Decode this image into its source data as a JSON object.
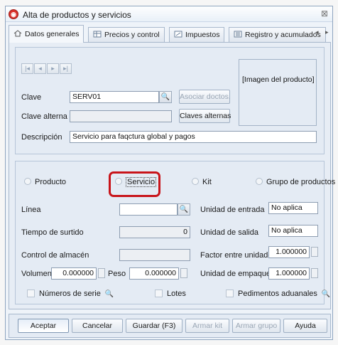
{
  "window": {
    "title": "Alta de productos y servicios",
    "close_glyph": "⊠"
  },
  "tabs": [
    {
      "label": "Datos generales",
      "icon": "home-icon"
    },
    {
      "label": "Precios y control",
      "icon": "table-icon"
    },
    {
      "label": "Impuestos",
      "icon": "tax-icon"
    },
    {
      "label": "Registro y acumulados",
      "icon": "ledger-icon"
    }
  ],
  "nav": {
    "first": "|◂",
    "prev": "◂",
    "next": "▸",
    "last": "▸|"
  },
  "form": {
    "clave_label": "Clave",
    "clave_value": "SERV01",
    "asociar_label": "Asociar doctos.",
    "clave_alterna_label": "Clave alterna",
    "clave_alterna_value": "",
    "claves_alternas_label": "Claves alternas",
    "descripcion_label": "Descripción",
    "descripcion_value": "Servicio para faqctura global y pagos",
    "image_placeholder": "[Imagen del producto]"
  },
  "type": {
    "options": [
      "Producto",
      "Servicio",
      "Kit",
      "Grupo de productos"
    ],
    "selected": "Servicio"
  },
  "details": {
    "linea_label": "Línea",
    "linea_value": "",
    "tiempo_label": "Tiempo de surtido",
    "tiempo_value": "0",
    "control_label": "Control de almacén",
    "control_value": "",
    "volumen_label": "Volumen",
    "volumen_value": "0.000000",
    "peso_label": "Peso",
    "peso_value": "0.000000",
    "unidad_entrada_label": "Unidad de entrada",
    "unidad_entrada_value": "No aplica",
    "unidad_salida_label": "Unidad de salida",
    "unidad_salida_value": "No aplica",
    "factor_label": "Factor entre unidades",
    "factor_value": "1.000000",
    "empaque_label": "Unidad de empaque",
    "empaque_value": "1.000000",
    "numeros_serie_label": "Números de serie",
    "lotes_label": "Lotes",
    "pedimentos_label": "Pedimentos aduanales"
  },
  "buttons": {
    "aceptar": "Aceptar",
    "cancelar": "Cancelar",
    "guardar": "Guardar (F3)",
    "armar_kit": "Armar kit",
    "armar_grupo": "Armar grupo",
    "ayuda": "Ayuda"
  },
  "colors": {
    "highlight": "#c8141a",
    "accent": "#d9302a"
  }
}
